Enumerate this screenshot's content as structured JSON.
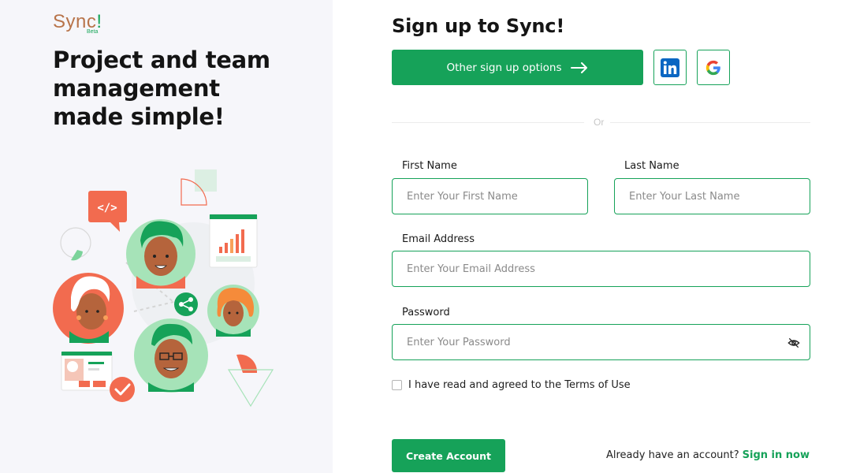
{
  "brand": {
    "name": "Sync",
    "mark": "!",
    "badge": "Beta"
  },
  "left": {
    "headline": "Project and team management made simple!"
  },
  "form": {
    "title": "Sign up to Sync!",
    "other_options_label": "Other sign up options",
    "social": [
      {
        "name": "LinkedIn",
        "icon": "linkedin-icon"
      },
      {
        "name": "Google",
        "icon": "google-icon"
      }
    ],
    "divider_text": "Or",
    "first_name": {
      "label": "First Name",
      "placeholder": "Enter Your First Name"
    },
    "last_name": {
      "label": "Last Name",
      "placeholder": "Enter Your Last Name"
    },
    "email": {
      "label": "Email Address",
      "placeholder": "Enter Your Email Address"
    },
    "password": {
      "label": "Password",
      "placeholder": "Enter Your Password",
      "toggle_icon": "eye-off-icon"
    },
    "terms_label": "I have read and agreed to the Terms of Use",
    "submit_label": "Create Account",
    "signin_prompt": "Already have an account?",
    "signin_link": "Sign in now"
  },
  "colors": {
    "accent": "#16a259",
    "panel": "#f6f6fa",
    "logo_brown": "#b8744a",
    "coral": "#f26b4f"
  }
}
